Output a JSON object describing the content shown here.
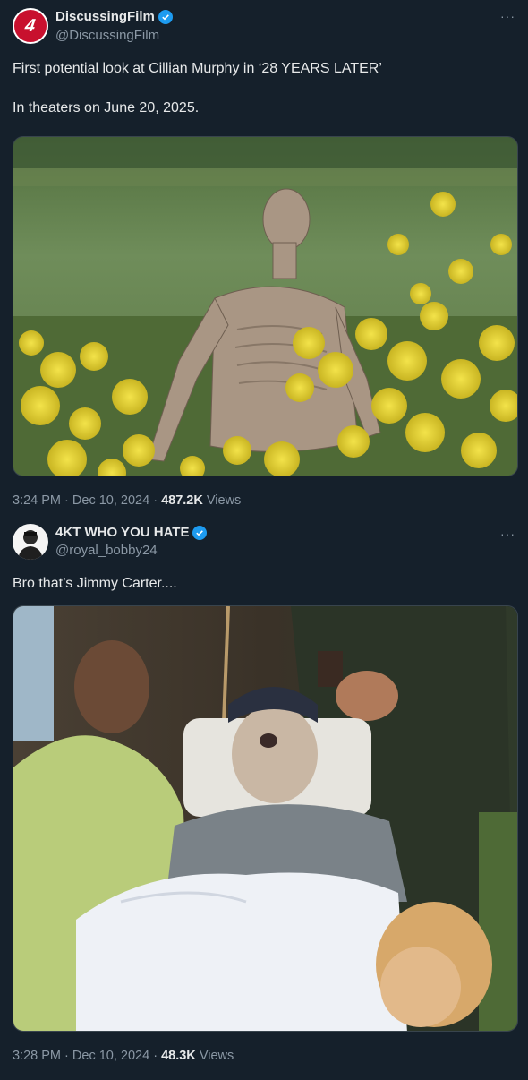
{
  "tweets": [
    {
      "display_name": "DiscussingFilm",
      "handle": "@DiscussingFilm",
      "avatar_text": "4",
      "more_label": "···",
      "text": "First potential look at Cillian Murphy in ‘28 YEARS LATER’\n\nIn theaters on June 20, 2025.",
      "time": "3:24 PM",
      "date": "Dec 10, 2024",
      "views_count": "487.2K",
      "views_label": "Views",
      "separator": "·"
    },
    {
      "display_name": "4KT WHO YOU HATE",
      "handle": "@royal_bobby24",
      "more_label": "···",
      "text": "Bro that’s Jimmy Carter....",
      "time": "3:28 PM",
      "date": "Dec 10, 2024",
      "views_count": "48.3K",
      "views_label": "Views",
      "separator": "·"
    }
  ],
  "colors": {
    "background": "#15202b",
    "verified": "#1d9bf0",
    "secondary_text": "#8b98a5",
    "flowers": "#e8d23a"
  }
}
